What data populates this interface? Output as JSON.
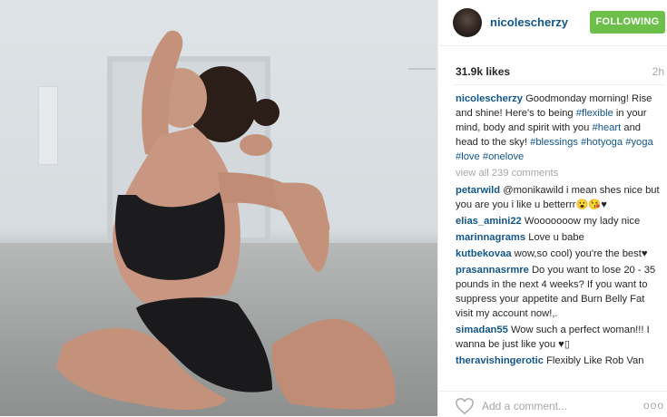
{
  "post": {
    "username": "nicolescherzy",
    "follow_label": "FOLLOWING",
    "likes": "31.9k likes",
    "time": "2h",
    "caption": {
      "user": "nicolescherzy",
      "parts": [
        {
          "text": "Goodmonday morning! Rise and shine! Here's to being ",
          "tag": false
        },
        {
          "text": "#flexible",
          "tag": true
        },
        {
          "text": " in your mind, body and spirit with you ",
          "tag": false
        },
        {
          "text": "#heart",
          "tag": true
        },
        {
          "text": " and head to the sky! ",
          "tag": false
        },
        {
          "text": "#blessings",
          "tag": true
        },
        {
          "text": " ",
          "tag": false
        },
        {
          "text": "#hotyoga",
          "tag": true
        },
        {
          "text": " ",
          "tag": false
        },
        {
          "text": "#yoga",
          "tag": true
        },
        {
          "text": " ",
          "tag": false
        },
        {
          "text": "#love",
          "tag": true
        },
        {
          "text": " ",
          "tag": false
        },
        {
          "text": "#onelove",
          "tag": true
        }
      ]
    },
    "view_all": "view all 239 comments",
    "comments": [
      {
        "user": "petarwild",
        "text": "@monikawild i mean shes nice but you are you i like u betterrr😮😘♥"
      },
      {
        "user": "elias_amini22",
        "text": "Wooooooow my lady nice"
      },
      {
        "user": "marinnagrams",
        "text": "Love u babe"
      },
      {
        "user": "kutbekovaa",
        "text": "wow,so cool) you're the best♥"
      },
      {
        "user": "prasannasrmre",
        "text": "Do you want to lose 20 - 35 pounds in the next 4 weeks? If you want to suppress your appetite and Burn Belly Fat visit my account now!,."
      },
      {
        "user": "simadan55",
        "text": "Wow such a perfect woman!!! I wanna be just like you ♥▯"
      },
      {
        "user": "theravishingerotic",
        "text": "Flexibly Like Rob Van"
      }
    ],
    "add_comment_placeholder": "Add a comment...",
    "more_label": "ooo"
  },
  "icons": {
    "like": "heart-icon",
    "options": "more-options-icon"
  },
  "colors": {
    "username": "#125688",
    "follow": "#6cc04a",
    "muted": "#a5a7aa"
  }
}
